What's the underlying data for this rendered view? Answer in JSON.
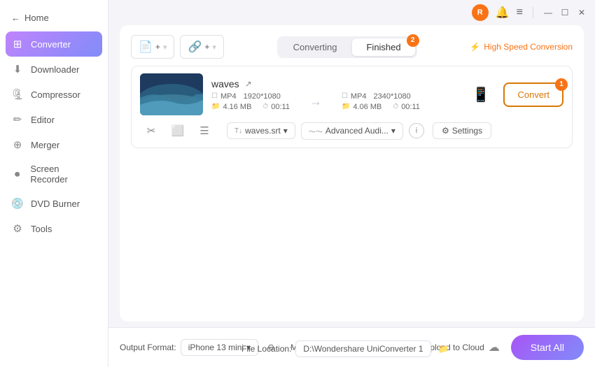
{
  "app": {
    "title": "Home"
  },
  "titlebar": {
    "avatar_label": "R",
    "bell_icon": "🔔",
    "menu_icon": "≡",
    "min_icon": "—",
    "max_icon": "☐",
    "close_icon": "✕"
  },
  "sidebar": {
    "back_label": "Home",
    "items": [
      {
        "id": "converter",
        "label": "Converter",
        "icon": "⊞",
        "active": true
      },
      {
        "id": "downloader",
        "label": "Downloader",
        "icon": "⬇",
        "active": false
      },
      {
        "id": "compressor",
        "label": "Compressor",
        "icon": "🗜",
        "active": false
      },
      {
        "id": "editor",
        "label": "Editor",
        "icon": "✏",
        "active": false
      },
      {
        "id": "merger",
        "label": "Merger",
        "icon": "⊕",
        "active": false
      },
      {
        "id": "screen-recorder",
        "label": "Screen Recorder",
        "icon": "⏺",
        "active": false
      },
      {
        "id": "dvd-burner",
        "label": "DVD Burner",
        "icon": "💿",
        "active": false
      },
      {
        "id": "tools",
        "label": "Tools",
        "icon": "⚙",
        "active": false
      }
    ]
  },
  "toolbar": {
    "add_file_label": "Add",
    "add_url_label": "Add URL"
  },
  "tabs": {
    "converting_label": "Converting",
    "finished_label": "Finished",
    "finished_badge": "2",
    "active": "finished"
  },
  "high_speed": {
    "label": "High Speed Conversion",
    "icon": "⚡"
  },
  "file": {
    "name": "waves",
    "external_link_icon": "↗",
    "source": {
      "format": "MP4",
      "resolution": "1920*1080",
      "size": "4.16 MB",
      "duration": "00:11"
    },
    "target": {
      "format": "MP4",
      "resolution": "2340*1080",
      "size": "4.06 MB",
      "duration": "00:11"
    }
  },
  "convert_btn": {
    "label": "Convert",
    "badge": "1"
  },
  "action_icons": {
    "cut": "✂",
    "crop": "⬜",
    "effects": "☰"
  },
  "subtitle": {
    "label": "waves.srt",
    "dropdown": "▾"
  },
  "audio": {
    "label": "Advanced Audi...",
    "dropdown": "▾"
  },
  "settings": {
    "label": "Settings",
    "icon": "⚙"
  },
  "bottom": {
    "output_format_label": "Output Format:",
    "output_format_value": "iPhone 13 mini",
    "file_location_label": "File Location:",
    "file_location_value": "D:\\Wondershare UniConverter 1",
    "merge_files_label": "Merge All Files:",
    "upload_label": "Upload to Cloud",
    "start_all_label": "Start All"
  }
}
